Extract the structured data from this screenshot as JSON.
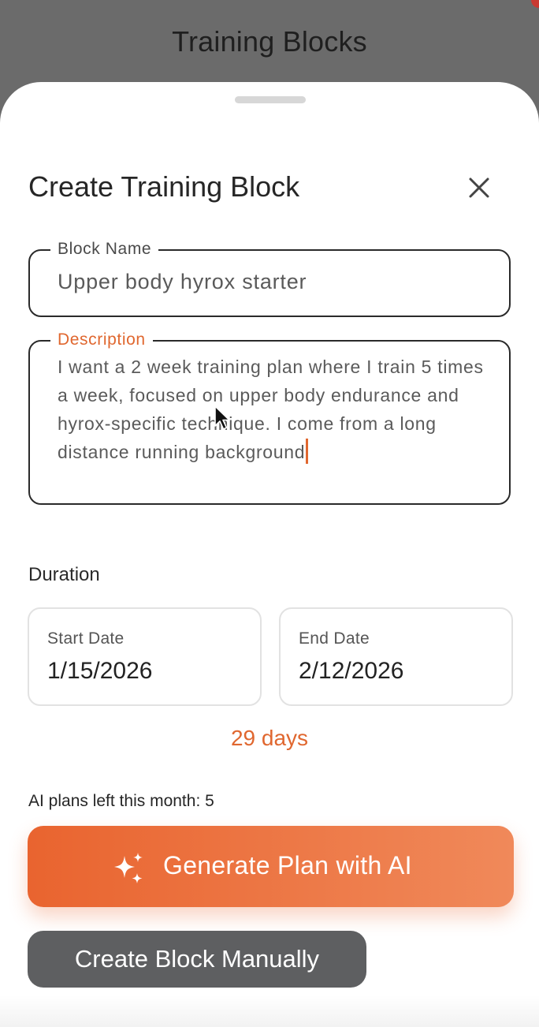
{
  "backdrop": {
    "title": "Training Blocks"
  },
  "sheet": {
    "title": "Create Training Block",
    "close_icon": "close-icon"
  },
  "form": {
    "block_name": {
      "label": "Block Name",
      "value": "Upper body hyrox starter"
    },
    "description": {
      "label": "Description",
      "value": "I want a 2 week training plan where I train 5 times a week, focused on upper body endurance and hyrox-specific technique. I come from a long distance running background",
      "focused": true
    }
  },
  "duration": {
    "label": "Duration",
    "start": {
      "caption": "Start Date",
      "value": "1/15/2026"
    },
    "end": {
      "caption": "End Date",
      "value": "2/12/2026"
    },
    "days": "29 days"
  },
  "ai": {
    "plans_left": "AI plans left this month: 5",
    "generate_label": "Generate Plan with AI",
    "generate_icon": "sparkles-icon"
  },
  "manual": {
    "label": "Create Block Manually"
  },
  "colors": {
    "accent": "#e9642f",
    "accent_light": "#f0895a",
    "secondary_button": "#5e5f61",
    "backdrop": "#6b6b6b"
  }
}
